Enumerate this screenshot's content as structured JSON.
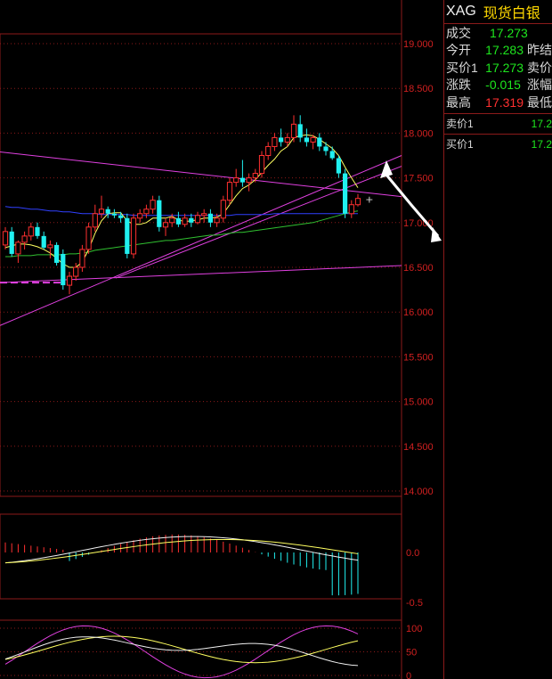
{
  "quote_panel": {
    "symbol": "XAG",
    "name": "现货白银",
    "rows": [
      {
        "label": "成交",
        "value": "17.273",
        "value_color": "#1ee61e",
        "extra": ""
      },
      {
        "label": "今开",
        "value": "17.283",
        "value_color": "#1ee61e",
        "extra": "昨结"
      },
      {
        "label": "买价1",
        "value": "17.273",
        "value_color": "#1ee61e",
        "extra": "卖价"
      },
      {
        "label": "涨跌",
        "value": "-0.015",
        "value_color": "#1ee61e",
        "extra": "涨幅"
      },
      {
        "label": "最高",
        "value": "17.319",
        "value_color": "#ff3030",
        "extra": "最低"
      }
    ],
    "book": [
      {
        "label": "卖价1",
        "value": "17.2"
      },
      {
        "label": "买价1",
        "value": "17.2"
      }
    ]
  },
  "chart_data": [
    {
      "type": "candlestick",
      "title": "",
      "yticks": [
        "19.000",
        "18.500",
        "18.000",
        "17.500",
        "17.000",
        "16.500",
        "16.000",
        "15.500",
        "15.000",
        "14.500",
        "14.000"
      ],
      "ylim": [
        14.0,
        19.0
      ],
      "grid": true,
      "candles": [
        [
          16.75,
          16.95,
          16.7,
          16.9
        ],
        [
          16.9,
          16.95,
          16.62,
          16.65
        ],
        [
          16.65,
          16.8,
          16.55,
          16.78
        ],
        [
          16.78,
          16.9,
          16.7,
          16.85
        ],
        [
          16.85,
          17.0,
          16.8,
          16.95
        ],
        [
          16.95,
          17.0,
          16.82,
          16.85
        ],
        [
          16.85,
          16.9,
          16.7,
          16.72
        ],
        [
          16.72,
          16.8,
          16.6,
          16.75
        ],
        [
          16.75,
          16.78,
          16.52,
          16.55
        ],
        [
          16.65,
          16.7,
          16.25,
          16.3
        ],
        [
          16.3,
          16.45,
          16.2,
          16.4
        ],
        [
          16.4,
          16.55,
          16.35,
          16.5
        ],
        [
          16.5,
          16.75,
          16.45,
          16.7
        ],
        [
          16.7,
          17.0,
          16.65,
          16.95
        ],
        [
          16.95,
          17.2,
          16.9,
          17.1
        ],
        [
          17.1,
          17.3,
          17.05,
          17.15
        ],
        [
          17.15,
          17.18,
          17.05,
          17.1
        ],
        [
          17.1,
          17.15,
          17.05,
          17.08
        ],
        [
          17.08,
          17.12,
          17.0,
          17.05
        ],
        [
          17.05,
          17.1,
          16.6,
          16.65
        ],
        [
          16.65,
          17.1,
          16.6,
          17.05
        ],
        [
          17.05,
          17.15,
          17.0,
          17.1
        ],
        [
          17.1,
          17.2,
          17.05,
          17.15
        ],
        [
          17.15,
          17.3,
          17.1,
          17.25
        ],
        [
          17.25,
          17.3,
          16.9,
          16.95
        ],
        [
          16.95,
          17.05,
          16.85,
          17.0
        ],
        [
          17.0,
          17.1,
          16.95,
          17.05
        ],
        [
          17.05,
          17.12,
          16.95,
          16.98
        ],
        [
          16.98,
          17.1,
          16.95,
          17.05
        ],
        [
          17.05,
          17.1,
          16.95,
          17.0
        ],
        [
          17.0,
          17.12,
          16.98,
          17.08
        ],
        [
          17.08,
          17.15,
          17.0,
          17.1
        ],
        [
          17.1,
          17.15,
          16.95,
          17.0
        ],
        [
          17.0,
          17.1,
          16.95,
          17.05
        ],
        [
          17.05,
          17.3,
          17.0,
          17.25
        ],
        [
          17.25,
          17.5,
          17.2,
          17.45
        ],
        [
          17.45,
          17.6,
          17.4,
          17.5
        ],
        [
          17.5,
          17.7,
          17.4,
          17.45
        ],
        [
          17.45,
          17.55,
          17.35,
          17.5
        ],
        [
          17.5,
          17.6,
          17.45,
          17.55
        ],
        [
          17.55,
          17.8,
          17.5,
          17.75
        ],
        [
          17.75,
          17.9,
          17.7,
          17.85
        ],
        [
          17.85,
          18.0,
          17.8,
          17.95
        ],
        [
          17.95,
          18.05,
          17.85,
          17.9
        ],
        [
          17.9,
          18.0,
          17.85,
          17.95
        ],
        [
          17.95,
          18.2,
          17.9,
          18.1
        ],
        [
          18.1,
          18.2,
          17.9,
          17.95
        ],
        [
          17.95,
          18.05,
          17.85,
          17.9
        ],
        [
          17.9,
          17.98,
          17.82,
          17.95
        ],
        [
          17.95,
          18.0,
          17.8,
          17.85
        ],
        [
          17.85,
          17.9,
          17.75,
          17.8
        ],
        [
          17.8,
          17.85,
          17.7,
          17.72
        ],
        [
          17.72,
          17.75,
          17.5,
          17.55
        ],
        [
          17.55,
          17.6,
          17.05,
          17.1
        ],
        [
          17.1,
          17.25,
          17.05,
          17.2
        ],
        [
          17.2,
          17.32,
          17.18,
          17.27
        ]
      ],
      "ma5": [
        16.72,
        16.74,
        16.76,
        16.76,
        16.75,
        16.73,
        16.7,
        16.66,
        16.6,
        16.54,
        16.5,
        16.5,
        16.56,
        16.7,
        16.88,
        17.02,
        17.1,
        17.11,
        17.11,
        17.02,
        16.98,
        16.98,
        17.0,
        17.05,
        17.05,
        17.05,
        17.07,
        17.03,
        17.01,
        17.02,
        17.03,
        17.05,
        17.05,
        17.06,
        17.1,
        17.2,
        17.3,
        17.38,
        17.42,
        17.48,
        17.56,
        17.64,
        17.71,
        17.8,
        17.85,
        17.95,
        17.97,
        17.98,
        17.97,
        17.93,
        17.88,
        17.83,
        17.75,
        17.62,
        17.5,
        17.39
      ],
      "ma_slow": [
        16.62,
        16.62,
        16.63,
        16.63,
        16.63,
        16.64,
        16.64,
        16.64,
        16.64,
        16.64,
        16.65,
        16.65,
        16.66,
        16.67,
        16.69,
        16.7,
        16.71,
        16.72,
        16.73,
        16.74,
        16.75,
        16.76,
        16.77,
        16.78,
        16.79,
        16.8,
        16.8,
        16.81,
        16.82,
        16.83,
        16.84,
        16.85,
        16.86,
        16.86,
        16.87,
        16.88,
        16.89,
        16.89,
        16.9,
        16.91,
        16.92,
        16.93,
        16.94,
        16.95,
        16.96,
        16.97,
        16.98,
        16.99,
        17.0,
        17.02,
        17.04,
        17.06,
        17.08,
        17.1,
        17.12,
        17.13
      ],
      "ma_long": [
        17.18,
        17.17,
        17.17,
        17.16,
        17.15,
        17.15,
        17.14,
        17.13,
        17.13,
        17.12,
        17.12,
        17.11,
        17.1,
        17.1,
        17.1,
        17.09,
        17.09,
        17.09,
        17.09,
        17.09,
        17.08,
        17.08,
        17.08,
        17.08,
        17.08,
        17.08,
        17.08,
        17.08,
        17.08,
        17.08,
        17.08,
        17.08,
        17.08,
        17.08,
        17.08,
        17.08,
        17.09,
        17.09,
        17.09,
        17.09,
        17.09,
        17.09,
        17.1,
        17.1,
        17.1,
        17.1,
        17.1,
        17.1,
        17.1,
        17.1,
        17.1,
        17.1,
        17.1,
        17.1,
        17.1,
        17.1
      ]
    },
    {
      "type": "bar",
      "title": "",
      "yticks": [
        "0.0",
        "-0.5"
      ],
      "ylim": [
        -0.5,
        0.5
      ]
    },
    {
      "type": "line",
      "title": "",
      "yticks": [
        "100",
        "50",
        "0"
      ],
      "ylim": [
        0,
        100
      ]
    }
  ],
  "colors": {
    "grid": "#8b1a1a",
    "axis_text": "#d02020",
    "up": "#ff3030",
    "down": "#20f0f0",
    "ma5": "#ffff60",
    "ma_slow": "#30c030",
    "ma_long": "#3040ff",
    "trend": "#e040e0",
    "annotation": "#ffffff"
  }
}
